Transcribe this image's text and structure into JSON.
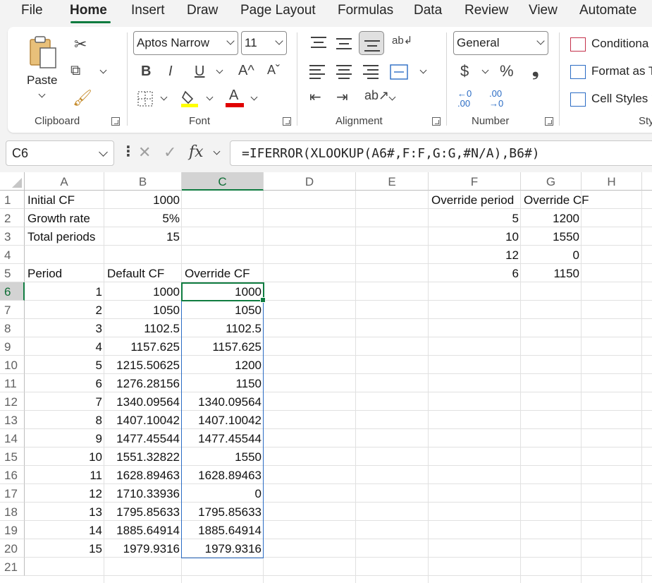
{
  "menu": {
    "tabs": [
      "File",
      "Home",
      "Insert",
      "Draw",
      "Page Layout",
      "Formulas",
      "Data",
      "Review",
      "View",
      "Automate"
    ],
    "active": "Home"
  },
  "ribbon": {
    "clipboard": {
      "paste_label": "Paste",
      "group_label": "Clipboard"
    },
    "font": {
      "family": "Aptos Narrow",
      "size": "11",
      "group_label": "Font",
      "bold": "B",
      "italic": "I",
      "underline": "U",
      "grow": "A^",
      "shrink": "Aˇ",
      "font_color_letter": "A",
      "highlight_color": "#ffff00",
      "font_color": "#e00000"
    },
    "alignment": {
      "group_label": "Alignment"
    },
    "number": {
      "format": "General",
      "group_label": "Number",
      "currency": "$",
      "percent": "%",
      "comma": "❟"
    },
    "styles": {
      "conditional": "Conditiona",
      "format_as": "Format as T",
      "cell_styles": "Cell Styles ˅",
      "group_label": "Sty"
    }
  },
  "formula_bar": {
    "name_box": "C6",
    "fx": "fx",
    "formula": "=IFERROR(XLOOKUP(A6#,F:F,G:G,#N/A),B6#)"
  },
  "sheet": {
    "columns": [
      "A",
      "B",
      "C",
      "D",
      "E",
      "F",
      "G",
      "H"
    ],
    "selected_column": "C",
    "rows": [
      "1",
      "2",
      "3",
      "4",
      "5",
      "6",
      "7",
      "8",
      "9",
      "10",
      "11",
      "12",
      "13",
      "14",
      "15",
      "16",
      "17",
      "18",
      "19",
      "20",
      "21"
    ],
    "selected_row": "6",
    "cells": {
      "A1": "Initial CF",
      "B1": "1000",
      "A2": "Growth rate",
      "B2": "5%",
      "A3": "Total periods",
      "B3": "15",
      "A5": "Period",
      "B5": "Default CF",
      "C5": "Override CF",
      "F1": "Override period",
      "G1": "Override CF",
      "F2": "5",
      "G2": "1200",
      "F3": "10",
      "G3": "1550",
      "F4": "12",
      "G4": "0",
      "F5": "6",
      "G5": "1150"
    },
    "table": [
      [
        "1",
        "1000",
        "1000"
      ],
      [
        "2",
        "1050",
        "1050"
      ],
      [
        "3",
        "1102.5",
        "1102.5"
      ],
      [
        "4",
        "1157.625",
        "1157.625"
      ],
      [
        "5",
        "1215.50625",
        "1200"
      ],
      [
        "6",
        "1276.28156",
        "1150"
      ],
      [
        "7",
        "1340.09564",
        "1340.09564"
      ],
      [
        "8",
        "1407.10042",
        "1407.10042"
      ],
      [
        "9",
        "1477.45544",
        "1477.45544"
      ],
      [
        "10",
        "1551.32822",
        "1550"
      ],
      [
        "11",
        "1628.89463",
        "1628.89463"
      ],
      [
        "12",
        "1710.33936",
        "0"
      ],
      [
        "13",
        "1795.85633",
        "1795.85633"
      ],
      [
        "14",
        "1885.64914",
        "1885.64914"
      ],
      [
        "15",
        "1979.9316",
        "1979.9316"
      ]
    ]
  }
}
